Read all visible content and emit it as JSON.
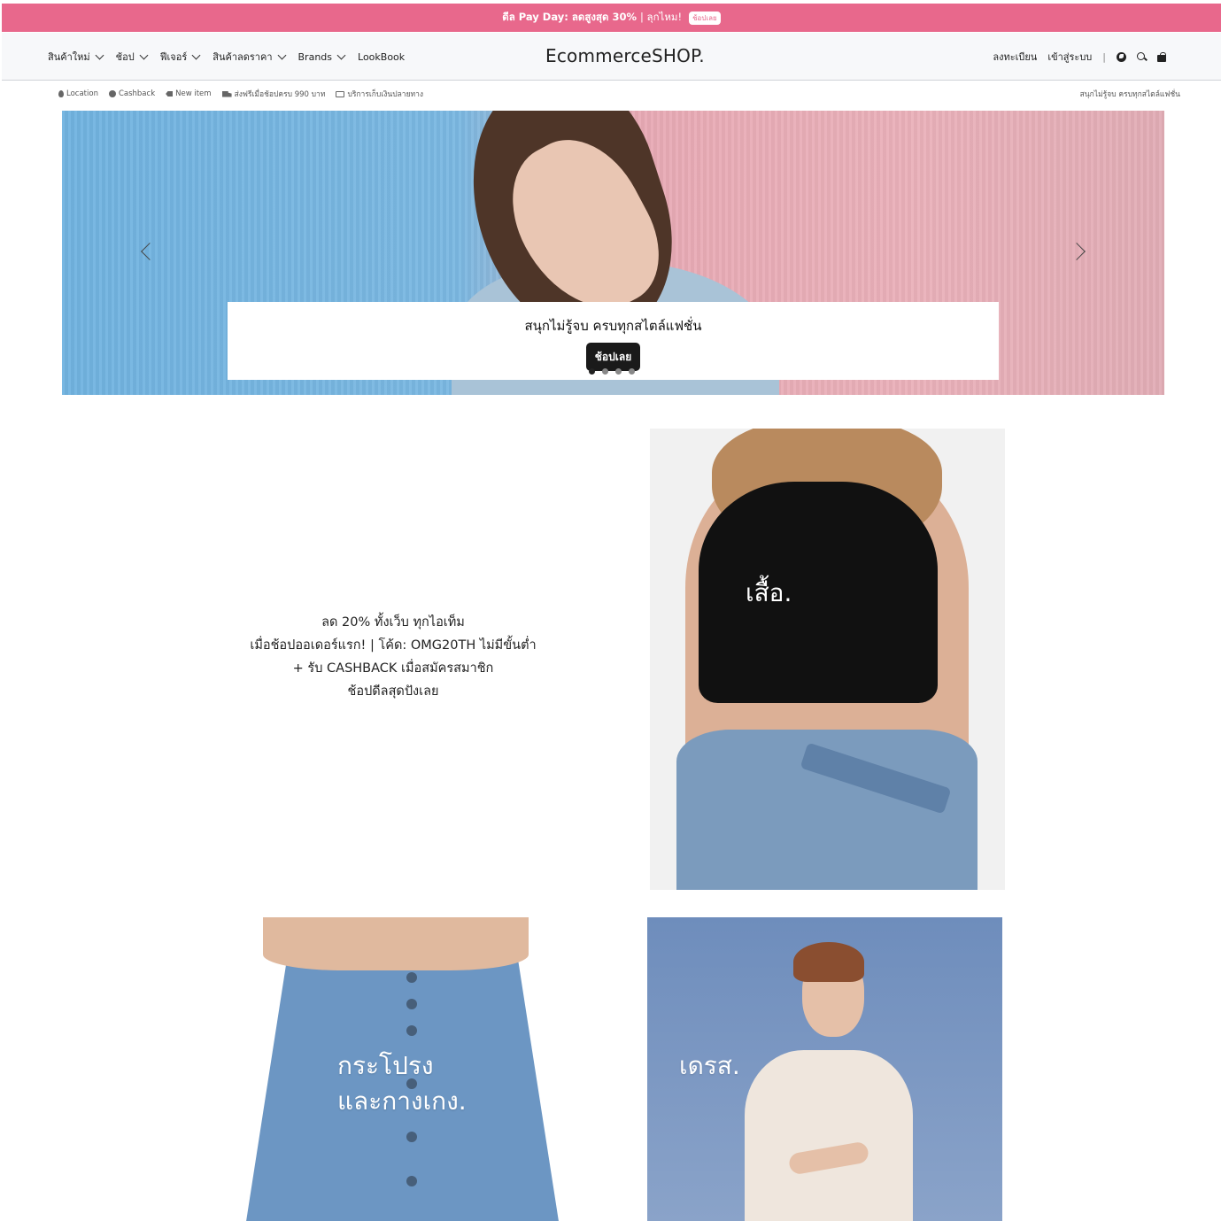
{
  "promo": {
    "part1": "ดีล Pay Day: ลดสูงสุด 30%",
    "part2": "| ลุกไหม!",
    "pill": "ช้อปเลย"
  },
  "nav": {
    "items": [
      {
        "label": "สินค้าใหม่",
        "dropdown": true
      },
      {
        "label": "ช้อป",
        "dropdown": true
      },
      {
        "label": "ฟีเจอร์",
        "dropdown": true
      },
      {
        "label": "สินค้าลดราคา",
        "dropdown": true
      },
      {
        "label": "Brands",
        "dropdown": true
      },
      {
        "label": "LookBook",
        "dropdown": false
      }
    ],
    "brand": "EcommerceSHOP.",
    "register": "ลงทะเบียน",
    "login": "เข้าสู่ระบบ",
    "separator": "|",
    "icons": [
      "globe-icon",
      "search-icon",
      "shopping-bag-icon"
    ]
  },
  "info_bar": {
    "items": [
      {
        "icon": "location-pin-icon",
        "label": "Location"
      },
      {
        "icon": "money-bag-icon",
        "label": "Cashback"
      },
      {
        "icon": "tag-icon",
        "label": "New item"
      },
      {
        "icon": "truck-icon",
        "label": "ส่งฟรีเมื่อช้อปครบ 990 บาท"
      },
      {
        "icon": "cash-icon",
        "label": "บริการเก็บเงินปลายทาง"
      }
    ],
    "right_text": "สนุกไม่รู้จบ ครบทุกสไตล์แฟชั่น"
  },
  "hero": {
    "caption": "สนุกไม่รู้จบ ครบทุกสไตล์แฟชั่น",
    "button": "ช้อปเลย",
    "slide_count": 4,
    "active_slide": 1
  },
  "promo_text": {
    "lines": [
      "ลด 20% ทั้งเว็บ ทุกไอเท็ม",
      "เมื่อช้อปออเดอร์แรก! | โค้ด: OMG20TH ไม่มีขั้นต่ำ",
      "+ รับ CASHBACK เมื่อสมัครสมาชิก",
      "ช้อปดีลสุดปังเลย"
    ]
  },
  "categories": [
    {
      "label": "เสื้อ."
    },
    {
      "label_line1": "กระโปรง",
      "label_line2": "และกางเกง."
    },
    {
      "label": "เดรส."
    }
  ],
  "colors": {
    "promo_bg": "#e8688c",
    "nav_bg": "#f7f8fa",
    "button_bg": "#1a1a1a"
  }
}
